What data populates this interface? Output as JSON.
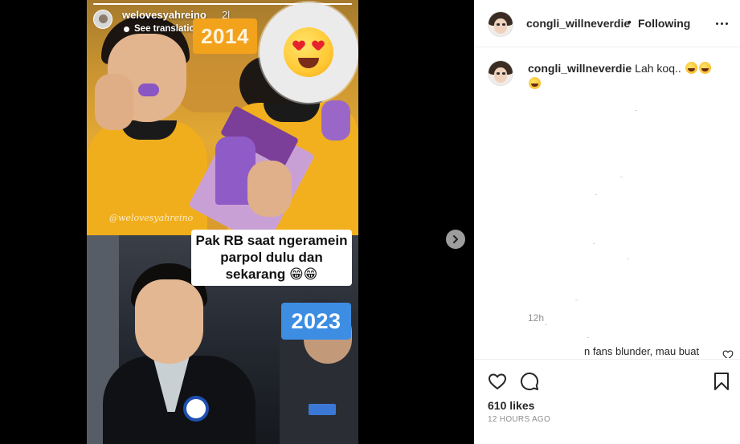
{
  "story": {
    "username": "welovesyahreino",
    "time": "2l",
    "translation_label": "See translation",
    "progress_fraction": 1.0,
    "sticker_year_top": "2014",
    "sticker_year_bottom": "2023",
    "emoji_sticker": "heart-eyes-emoji",
    "caption_lines": [
      "Pak RB saat ngeramein",
      "parpol dulu dan",
      "sekarang 😁😁"
    ],
    "watermark": "@welovesyahreino"
  },
  "navigation": {
    "next_icon": "chevron-right-icon"
  },
  "post": {
    "username": "congli_willneverdie",
    "separator": "•",
    "follow_status": "Following",
    "more_icon": "more-options-icon"
  },
  "comments": [
    {
      "username": "congli_willneverdie",
      "text": "Lah koq..",
      "emojis": "🤣🤣🤣",
      "time": "12h"
    }
  ],
  "next_comment_preview": "n fans blunder, mau buat",
  "actions": {
    "like_icon": "heart-icon",
    "comment_icon": "comment-bubble-icon",
    "save_icon": "bookmark-icon"
  },
  "likes_label": "610 likes",
  "post_age": "12 HOURS AGO",
  "colors": {
    "year_2014_bg": "#f3a21c",
    "year_2023_bg": "#3d8de3",
    "sidebar_bg": "#ffffff",
    "secondary_text": "#8e8e8e"
  }
}
